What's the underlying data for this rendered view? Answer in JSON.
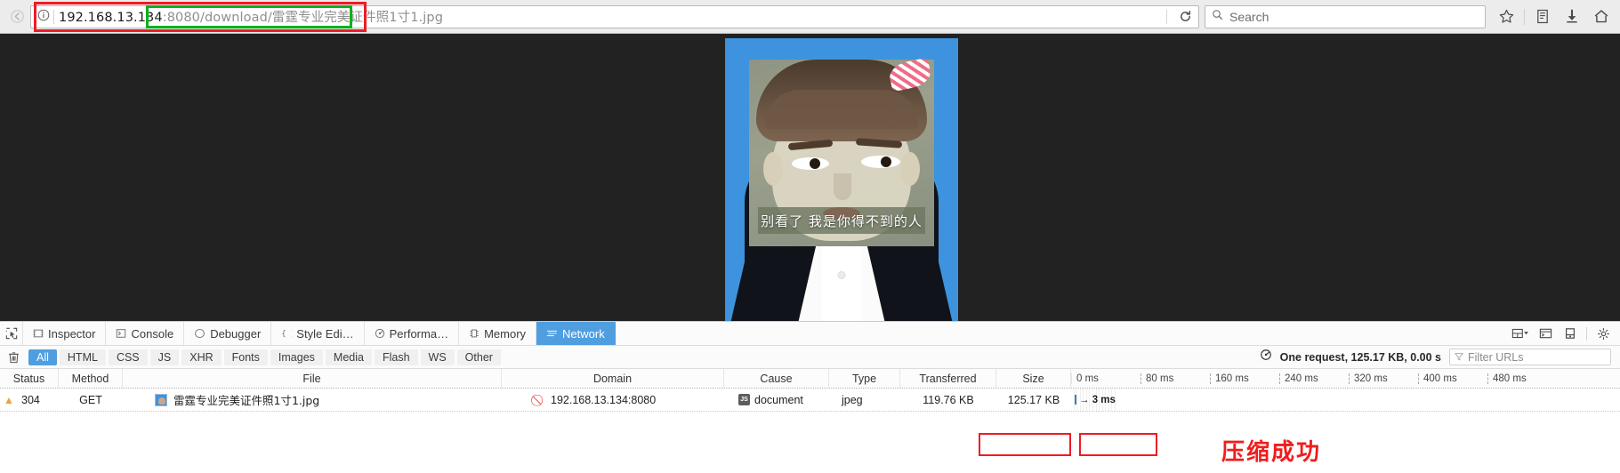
{
  "browser": {
    "back_icon": "back-arrow-icon",
    "identity_icon": "page-info-icon",
    "url": {
      "host": "192.168.13.134",
      "port": ":8080",
      "path": "/download/雷霆专业完美证件照1寸1.jpg"
    },
    "reload_icon": "reload-icon",
    "search_placeholder": "Search",
    "toolbar_icons": [
      "bookmark-star-icon",
      "library-icon",
      "downloads-icon",
      "home-icon"
    ]
  },
  "annotations": {
    "url_red_box": "highlight url",
    "url_green_box": "highlight path",
    "devtools_note": "压缩成功"
  },
  "page": {
    "image_caption": "别看了 我是你得不到的人"
  },
  "devtools": {
    "picker_icon": "element-picker-icon",
    "tabs": [
      {
        "label": "Inspector",
        "icon": "inspector-icon",
        "active": false
      },
      {
        "label": "Console",
        "icon": "console-icon",
        "active": false
      },
      {
        "label": "Debugger",
        "icon": "debugger-icon",
        "active": false
      },
      {
        "label": "Style Edi…",
        "icon": "style-editor-icon",
        "active": false
      },
      {
        "label": "Performa…",
        "icon": "performance-icon",
        "active": false
      },
      {
        "label": "Memory",
        "icon": "memory-icon",
        "active": false
      },
      {
        "label": "Network",
        "icon": "network-icon",
        "active": true
      }
    ],
    "right_buttons": [
      "layout-toggle-icon",
      "split-console-icon",
      "responsive-mode-icon",
      "settings-gear-icon"
    ],
    "clear_icon": "trash-icon",
    "filters": [
      {
        "label": "All",
        "active": true
      },
      {
        "label": "HTML",
        "active": false
      },
      {
        "label": "CSS",
        "active": false
      },
      {
        "label": "JS",
        "active": false
      },
      {
        "label": "XHR",
        "active": false
      },
      {
        "label": "Fonts",
        "active": false
      },
      {
        "label": "Images",
        "active": false
      },
      {
        "label": "Media",
        "active": false
      },
      {
        "label": "Flash",
        "active": false
      },
      {
        "label": "WS",
        "active": false
      },
      {
        "label": "Other",
        "active": false
      }
    ],
    "summary_icon": "performance-analysis-icon",
    "summary": "One request, 125.17 KB, 0.00 s",
    "filter_placeholder": "Filter URLs",
    "columns": [
      "Status",
      "Method",
      "File",
      "Domain",
      "Cause",
      "Type",
      "Transferred",
      "Size"
    ],
    "rows": [
      {
        "warning_icon": "warning-triangle-icon",
        "status": "304",
        "method": "GET",
        "file_icon": "jpeg-favicon",
        "file": "雷霆专业完美证件照1寸1.jpg",
        "domain_icon": "no-cookie-icon",
        "domain": "192.168.13.134:8080",
        "cause_icon": "js-badge-icon",
        "cause": "document",
        "type": "jpeg",
        "transferred": "119.76 KB",
        "size": "125.17 KB",
        "timing": "→ 3 ms"
      }
    ],
    "timeline_ticks": [
      "0 ms",
      "80 ms",
      "160 ms",
      "240 ms",
      "320 ms",
      "400 ms",
      "480 ms"
    ]
  },
  "colors": {
    "accent": "#4f9ee0",
    "annotation_red": "#ee1b24",
    "annotation_green": "#00b21a",
    "photo_bg": "#3d93dd"
  }
}
